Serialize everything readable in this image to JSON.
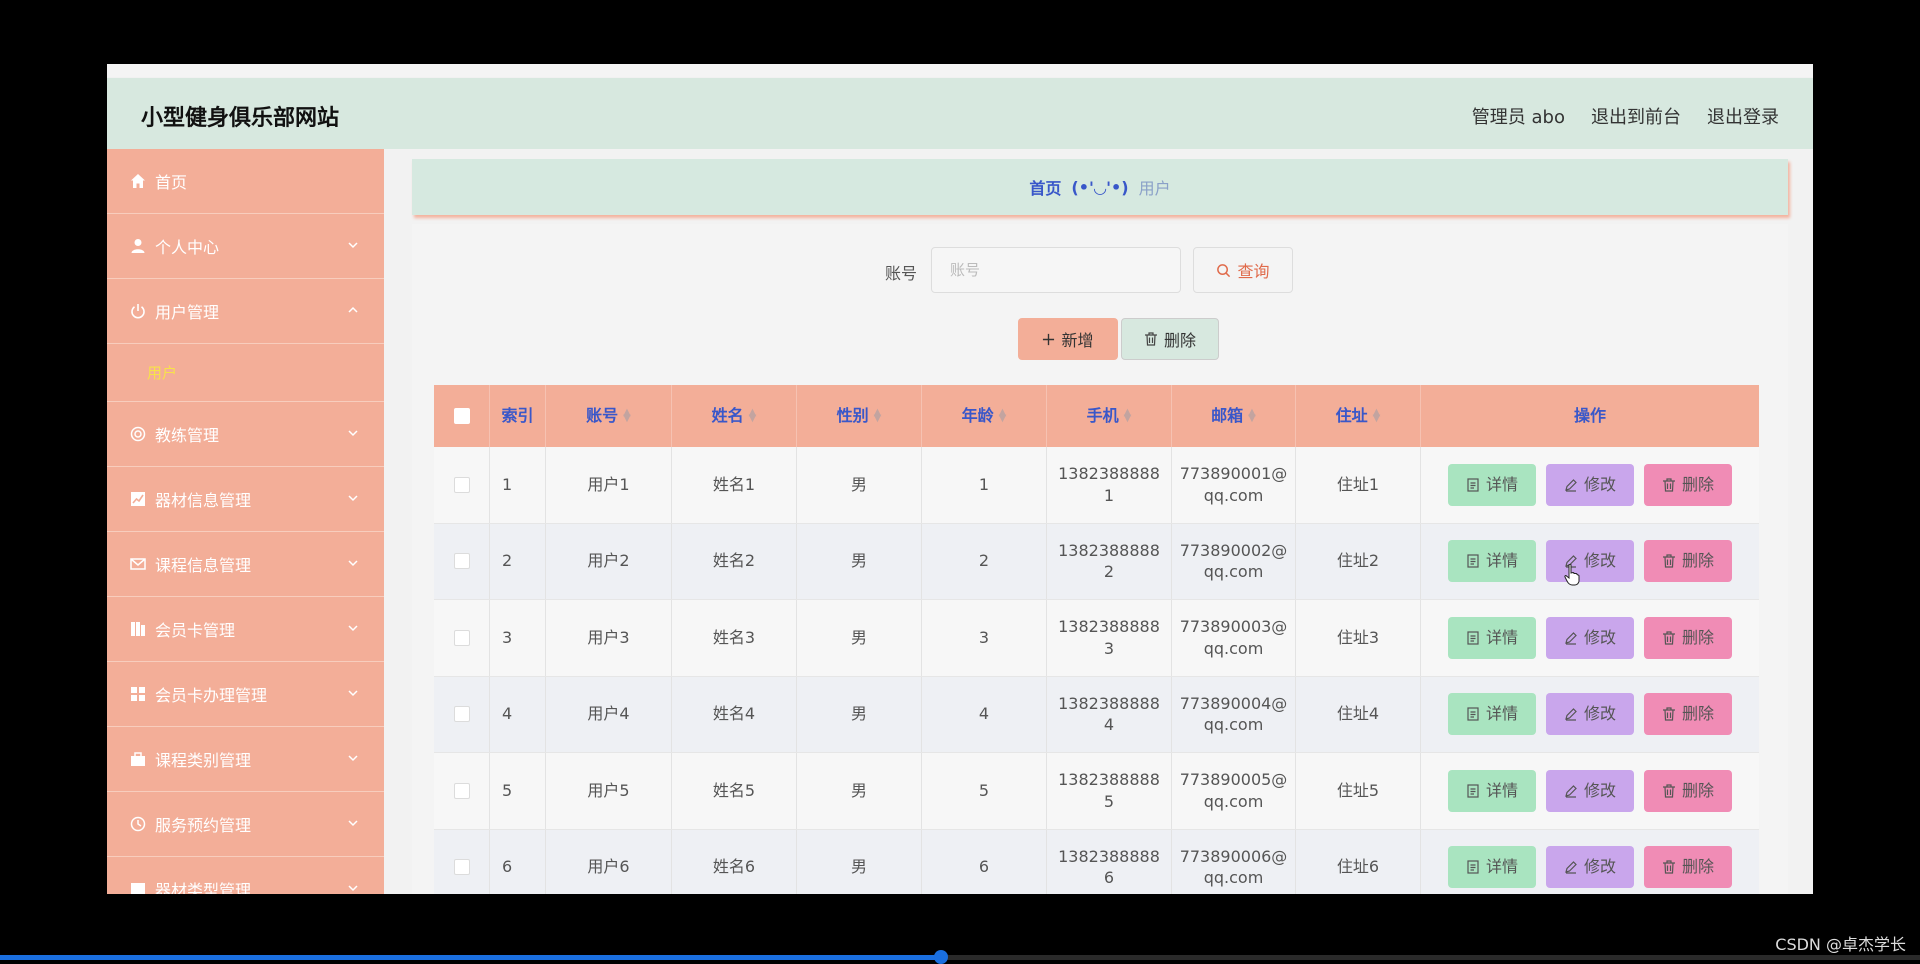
{
  "app": {
    "title": "小型健身俱乐部网站",
    "header_links": [
      "管理员 abo",
      "退出到前台",
      "退出登录"
    ]
  },
  "sidebar": {
    "items": [
      {
        "label": "首页",
        "icon": "home-icon",
        "chevron": ""
      },
      {
        "label": "个人中心",
        "icon": "user-icon",
        "chevron": "down"
      },
      {
        "label": "用户管理",
        "icon": "power-icon",
        "chevron": "up"
      },
      {
        "label": "教练管理",
        "icon": "target-icon",
        "chevron": "down"
      },
      {
        "label": "器材信息管理",
        "icon": "chart-icon",
        "chevron": "down"
      },
      {
        "label": "课程信息管理",
        "icon": "mail-icon",
        "chevron": "down"
      },
      {
        "label": "会员卡管理",
        "icon": "card-icon",
        "chevron": "down"
      },
      {
        "label": "会员卡办理管理",
        "icon": "grid-icon",
        "chevron": "down"
      },
      {
        "label": "课程类别管理",
        "icon": "briefcase-icon",
        "chevron": "down"
      },
      {
        "label": "服务预约管理",
        "icon": "clock-icon",
        "chevron": "down"
      },
      {
        "label": "器材类型管理",
        "icon": "box-icon",
        "chevron": "down"
      }
    ],
    "subitem": "用户",
    "subitem_color": "#f7e24a"
  },
  "breadcrumb": {
    "home": "首页",
    "separator": "(•'◡'•)",
    "current": "用户"
  },
  "search": {
    "label": "账号",
    "placeholder": "账号",
    "value": "",
    "button": "查询"
  },
  "actions": {
    "add": "新增",
    "delete": "删除"
  },
  "table": {
    "headers": [
      "索引",
      "账号",
      "姓名",
      "性别",
      "年龄",
      "手机",
      "邮箱",
      "住址",
      "操作"
    ],
    "rows": [
      {
        "index": "1",
        "account": "用户1",
        "name": "姓名1",
        "gender": "男",
        "age": "1",
        "phone_a": "1382388888",
        "phone_b": "1",
        "email_a": "773890001@",
        "email_b": "qq.com",
        "address": "住址1"
      },
      {
        "index": "2",
        "account": "用户2",
        "name": "姓名2",
        "gender": "男",
        "age": "2",
        "phone_a": "1382388888",
        "phone_b": "2",
        "email_a": "773890002@",
        "email_b": "qq.com",
        "address": "住址2"
      },
      {
        "index": "3",
        "account": "用户3",
        "name": "姓名3",
        "gender": "男",
        "age": "3",
        "phone_a": "1382388888",
        "phone_b": "3",
        "email_a": "773890003@",
        "email_b": "qq.com",
        "address": "住址3"
      },
      {
        "index": "4",
        "account": "用户4",
        "name": "姓名4",
        "gender": "男",
        "age": "4",
        "phone_a": "1382388888",
        "phone_b": "4",
        "email_a": "773890004@",
        "email_b": "qq.com",
        "address": "住址4"
      },
      {
        "index": "5",
        "account": "用户5",
        "name": "姓名5",
        "gender": "男",
        "age": "5",
        "phone_a": "1382388888",
        "phone_b": "5",
        "email_a": "773890005@",
        "email_b": "qq.com",
        "address": "住址5"
      },
      {
        "index": "6",
        "account": "用户6",
        "name": "姓名6",
        "gender": "男",
        "age": "6",
        "phone_a": "1382388888",
        "phone_b": "6",
        "email_a": "773890006@",
        "email_b": "qq.com",
        "address": "住址6"
      }
    ],
    "row_actions": {
      "view": "详情",
      "edit": "修改",
      "delete": "删除"
    }
  },
  "colors": {
    "header_bg": "#d7e8df",
    "sidebar_bg": "#f3ae98",
    "accent_text": "#3957c9",
    "view_button": "#a9e4c0",
    "edit_button": "#c9a6ec",
    "delete_button": "#f08cb5"
  },
  "video": {
    "progress": 0.49
  },
  "watermark": "CSDN @卓杰学长"
}
